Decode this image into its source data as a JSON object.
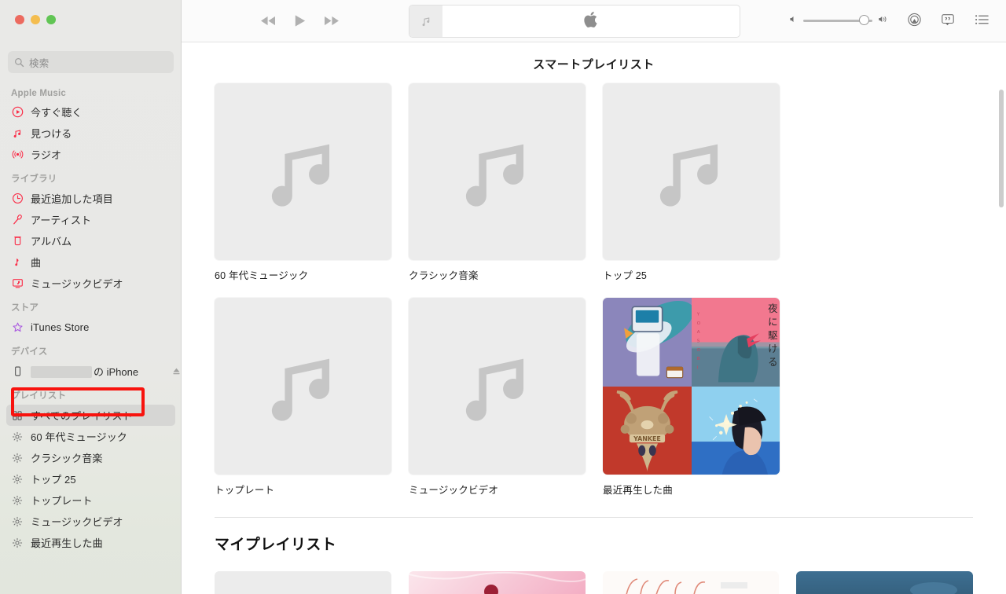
{
  "window": {
    "traffic_lights": [
      {
        "name": "close",
        "color": "#ec6a5f"
      },
      {
        "name": "minimize",
        "color": "#f4bd4f"
      },
      {
        "name": "maximize",
        "color": "#61c554"
      }
    ]
  },
  "search": {
    "placeholder": "検索",
    "value": "",
    "icon": "search-icon"
  },
  "sidebar": {
    "groups": [
      {
        "title": "Apple Music",
        "items": [
          {
            "label": "今すぐ聴く",
            "icon": "play-circle-icon",
            "selected": false
          },
          {
            "label": "見つける",
            "icon": "music-note-icon",
            "selected": false
          },
          {
            "label": "ラジオ",
            "icon": "radio-broadcast-icon",
            "selected": false
          }
        ]
      },
      {
        "title": "ライブラリ",
        "items": [
          {
            "label": "最近追加した項目",
            "icon": "clock-icon",
            "selected": false
          },
          {
            "label": "アーティスト",
            "icon": "microphone-icon",
            "selected": false
          },
          {
            "label": "アルバム",
            "icon": "album-icon",
            "selected": false
          },
          {
            "label": "曲",
            "icon": "single-note-icon",
            "selected": false
          },
          {
            "label": "ミュージックビデオ",
            "icon": "music-video-icon",
            "selected": false
          }
        ]
      },
      {
        "title": "ストア",
        "items": [
          {
            "label": "iTunes Store",
            "icon": "star-icon",
            "selected": false
          }
        ]
      },
      {
        "title": "デバイス",
        "items": [
          {
            "label": "の iPhone",
            "redacted_prefix": true,
            "icon": "iphone-icon",
            "selected": false,
            "eject": true,
            "highlighted": true
          }
        ]
      },
      {
        "title": "プレイリスト",
        "items": [
          {
            "label": "すべてのプレイリスト",
            "icon": "grid-icon",
            "selected": true
          },
          {
            "label": "60 年代ミュージック",
            "icon": "gear-icon",
            "selected": false
          },
          {
            "label": "クラシック音楽",
            "icon": "gear-icon",
            "selected": false
          },
          {
            "label": "トップ 25",
            "icon": "gear-icon",
            "selected": false
          },
          {
            "label": "トップレート",
            "icon": "gear-icon",
            "selected": false
          },
          {
            "label": "ミュージックビデオ",
            "icon": "gear-icon",
            "selected": false
          },
          {
            "label": "最近再生した曲",
            "icon": "gear-icon",
            "selected": false
          }
        ]
      }
    ]
  },
  "toolbar": {
    "transport": [
      {
        "name": "rewind-button",
        "icon": "rewind-icon"
      },
      {
        "name": "play-button",
        "icon": "play-icon"
      },
      {
        "name": "fast-forward-button",
        "icon": "fast-forward-icon"
      }
    ],
    "lcd": {
      "artwork_icon": "music-note-icon",
      "center_icon": "apple-logo-icon",
      "title": ""
    },
    "volume": {
      "level_percent": 82,
      "min_icon": "volume-min-icon",
      "max_icon": "volume-max-icon"
    },
    "right_icons": [
      {
        "name": "airplay-button",
        "icon": "airplay-icon"
      },
      {
        "name": "lyrics-button",
        "icon": "lyrics-icon"
      },
      {
        "name": "queue-button",
        "icon": "queue-list-icon"
      }
    ]
  },
  "main": {
    "smart_section": {
      "title": "スマートプレイリスト",
      "tiles": [
        {
          "label": "60 年代ミュージック",
          "art": "note-placeholder"
        },
        {
          "label": "クラシック音楽",
          "art": "note-placeholder"
        },
        {
          "label": "トップ 25",
          "art": "note-placeholder"
        },
        {
          "label": "トップレート",
          "art": "note-placeholder"
        },
        {
          "label": "ミュージックビデオ",
          "art": "note-placeholder"
        },
        {
          "label": "最近再生した曲",
          "art": "collage"
        }
      ],
      "collage_quadrants": [
        {
          "name": "album-art-1",
          "colors": [
            "#8b7fb5",
            "#2f9fa8",
            "#e8eaf2"
          ]
        },
        {
          "name": "album-art-yoasobi-yoru-ni-kakeru",
          "colors": [
            "#f2788f",
            "#3c6b7d",
            "#d9415a"
          ]
        },
        {
          "name": "album-art-yankee",
          "colors": [
            "#c8352a",
            "#c7a576"
          ]
        },
        {
          "name": "album-art-blue-portrait",
          "colors": [
            "#2f7fd1",
            "#9fd4f2",
            "#1a1a24"
          ]
        }
      ]
    },
    "my_section": {
      "title": "マイプレイリスト",
      "tiles": [
        {
          "name": "my-playlist-tile-1",
          "color": "#ececec"
        },
        {
          "name": "my-playlist-tile-2",
          "color": "#f5c6d4"
        },
        {
          "name": "my-playlist-tile-3",
          "color": "#fbf7f5"
        },
        {
          "name": "my-playlist-tile-4",
          "color": "#3f6f93"
        }
      ]
    }
  }
}
